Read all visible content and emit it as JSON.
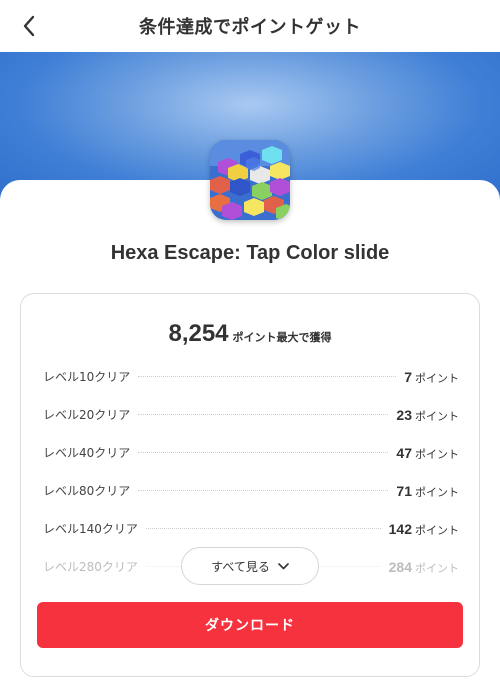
{
  "header": {
    "title": "条件達成でポイントゲット"
  },
  "app": {
    "name": "Hexa Escape: Tap Color slide"
  },
  "reward": {
    "total": "8,254",
    "total_suffix": "ポイント最大で獲得"
  },
  "levels": [
    {
      "label": "レベル10クリア",
      "points": "7",
      "unit": "ポイント"
    },
    {
      "label": "レベル20クリア",
      "points": "23",
      "unit": "ポイント"
    },
    {
      "label": "レベル40クリア",
      "points": "47",
      "unit": "ポイント"
    },
    {
      "label": "レベル80クリア",
      "points": "71",
      "unit": "ポイント"
    },
    {
      "label": "レベル140クリア",
      "points": "142",
      "unit": "ポイント"
    },
    {
      "label": "レベル280クリア",
      "points": "284",
      "unit": "ポイント"
    }
  ],
  "actions": {
    "see_all": "すべて見る",
    "download": "ダウンロード"
  },
  "colors": {
    "accent": "#f5323d",
    "hero": "#3f7fd6"
  },
  "icons": {
    "back": "chevron-left-icon",
    "expand": "chevron-down-icon"
  }
}
